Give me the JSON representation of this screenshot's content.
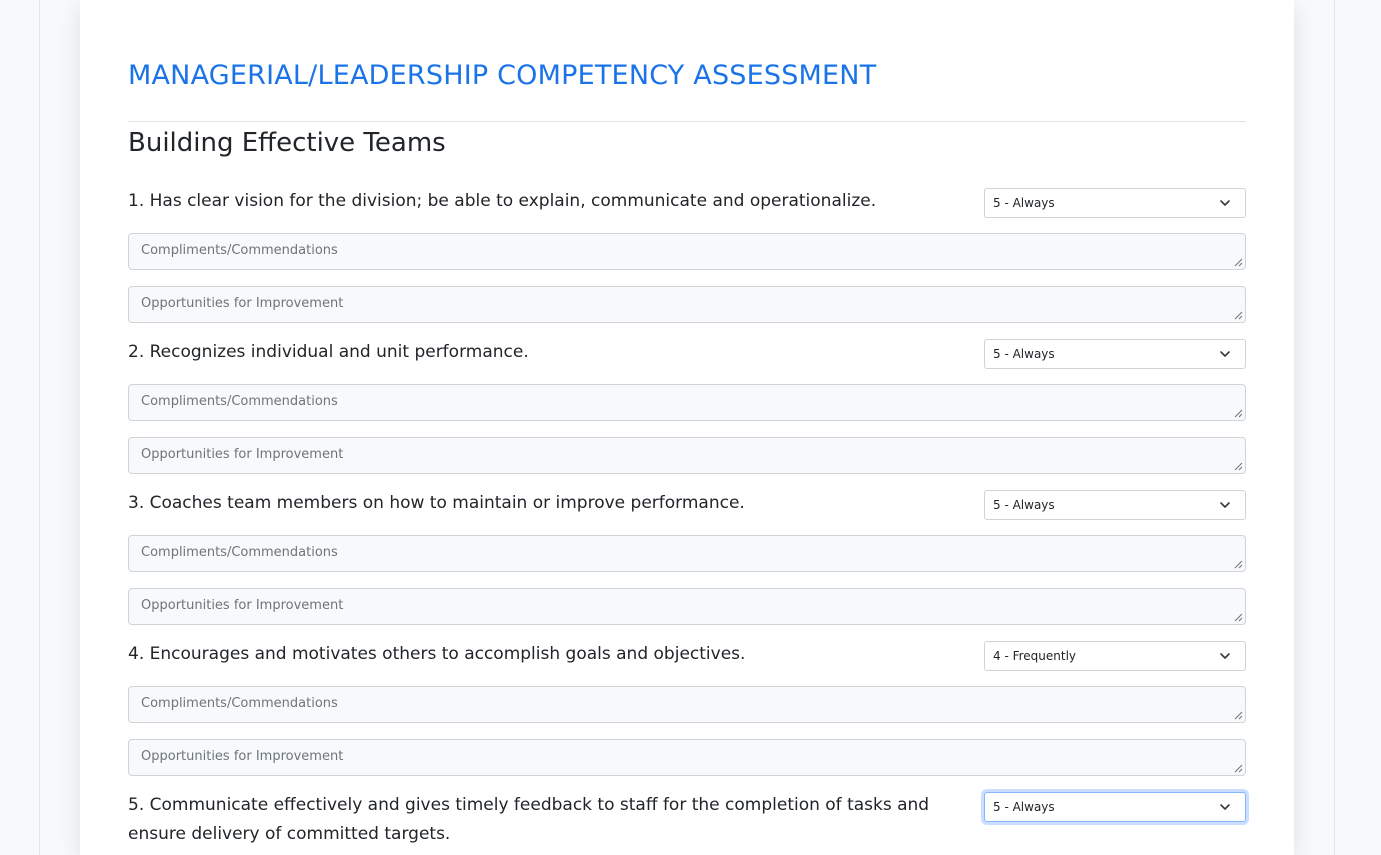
{
  "page": {
    "title": "MANAGERIAL/LEADERSHIP COMPETENCY ASSESSMENT",
    "section_title": "Building Effective Teams"
  },
  "colors": {
    "title_blue": "#1a73e8",
    "focus_ring": "#86b7fe"
  },
  "placeholders": {
    "compliments": "Compliments/Commendations",
    "improvement": "Opportunities for Improvement"
  },
  "questions": [
    {
      "text": "1. Has clear vision for the division; be able to explain, communicate and operationalize.",
      "rating": "5 - Always"
    },
    {
      "text": "2. Recognizes individual and unit performance.",
      "rating": "5 - Always"
    },
    {
      "text": "3. Coaches team members on how to maintain or improve performance.",
      "rating": "5 - Always"
    },
    {
      "text": "4. Encourages and motivates others to accomplish goals and objectives.",
      "rating": "4 - Frequently"
    },
    {
      "text": "5. Communicate effectively and gives timely feedback to staff for the completion of tasks and ensure delivery of committed targets.",
      "rating": "5 - Always"
    }
  ]
}
